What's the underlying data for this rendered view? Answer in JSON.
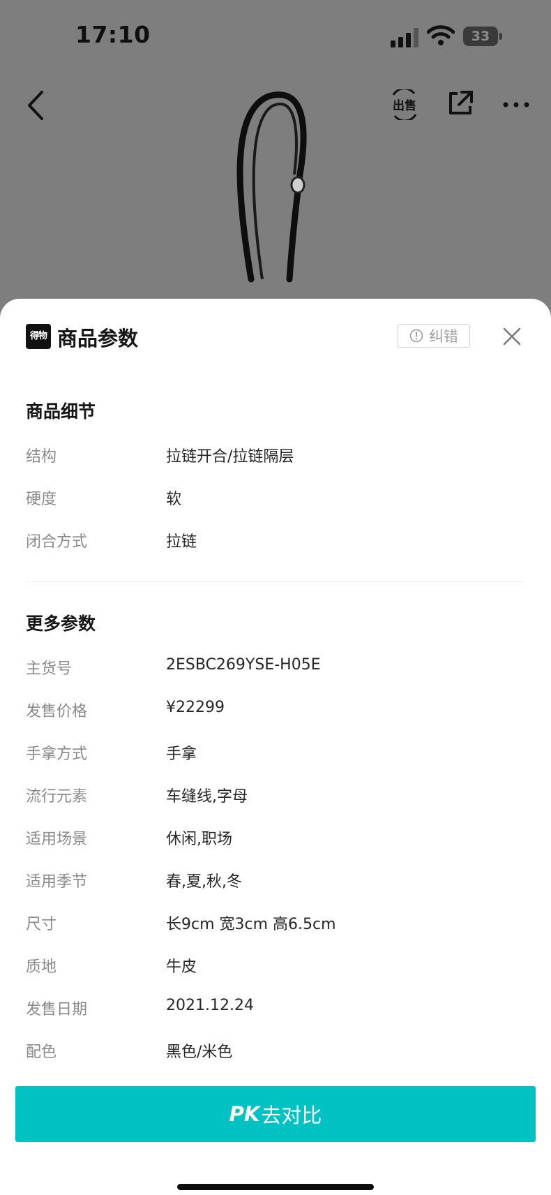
{
  "status_bar": {
    "time": "17:10",
    "battery": "33"
  },
  "nav": {
    "back_icon": "chevron-left-icon",
    "resell_icon": "resell-icon",
    "resell_label": "出售",
    "share_icon": "share-external-icon",
    "more_icon": "more-dots-icon"
  },
  "sheet": {
    "brand_logo": "得物",
    "title": "商品参数",
    "report_label": "纠错",
    "close_icon": "close-icon",
    "sections": [
      {
        "title": "商品细节",
        "rows": [
          {
            "key": "结构",
            "value": "拉链开合/拉链隔层"
          },
          {
            "key": "硬度",
            "value": "软"
          },
          {
            "key": "闭合方式",
            "value": "拉链"
          }
        ]
      },
      {
        "title": "更多参数",
        "rows": [
          {
            "key": "主货号",
            "value": "2ESBC269YSE-H05E"
          },
          {
            "key": "发售价格",
            "value": "¥22299"
          },
          {
            "key": "手拿方式",
            "value": "手拿"
          },
          {
            "key": "流行元素",
            "value": "车缝线,字母"
          },
          {
            "key": "适用场景",
            "value": "休闲,职场"
          },
          {
            "key": "适用季节",
            "value": "春,夏,秋,冬"
          },
          {
            "key": "尺寸",
            "value": "长9cm 宽3cm 高6.5cm"
          },
          {
            "key": "质地",
            "value": "牛皮"
          },
          {
            "key": "发售日期",
            "value": "2021.12.24"
          },
          {
            "key": "配色",
            "value": "黑色/米色"
          }
        ]
      }
    ],
    "pk_button": {
      "prefix": "PK",
      "label": "去对比"
    }
  },
  "colors": {
    "accent": "#01c2c3",
    "overlay": "#7e7e7e"
  }
}
